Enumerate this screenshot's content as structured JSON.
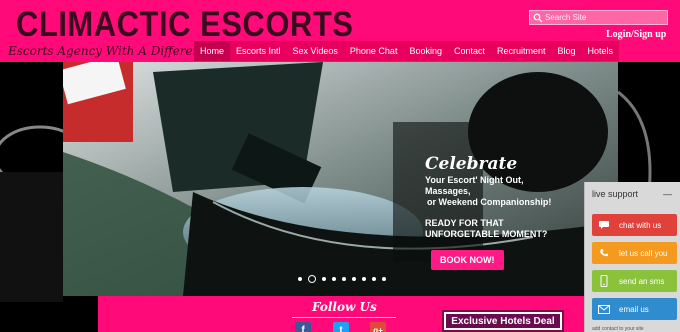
{
  "brand": {
    "logo": "CLIMACTIC ESCORTS",
    "tagline": "Escorts Agency With A Difference"
  },
  "search": {
    "placeholder": "Search Site"
  },
  "auth": {
    "login_label": "Login/Sign up"
  },
  "nav": {
    "items": [
      {
        "label": "Home",
        "active": true
      },
      {
        "label": "Escorts Intl",
        "active": false
      },
      {
        "label": "Sex Videos",
        "active": false
      },
      {
        "label": "Phone Chat",
        "active": false
      },
      {
        "label": "Booking",
        "active": false
      },
      {
        "label": "Contact",
        "active": false
      },
      {
        "label": "Recruitment",
        "active": false
      },
      {
        "label": "Blog",
        "active": false
      },
      {
        "label": "Hotels",
        "active": false
      }
    ]
  },
  "slider": {
    "heading": "Celebrate",
    "line1": "Your Escort' Night Out,",
    "line2": "Massages,",
    "line3": "or Weekend Companionship!",
    "ready1": "READY FOR THAT",
    "ready2": "UNFORGETABLE MOMENT?",
    "cta": "BOOK NOW!",
    "dot_count": 9,
    "active_dot": 1
  },
  "footer": {
    "follow_title": "Follow Us",
    "social": [
      "facebook-icon",
      "twitter-icon",
      "google-plus-icon"
    ],
    "hotels_deal": "Exclusive Hotels Deal"
  },
  "live_support": {
    "title": "live support",
    "toggle": "—",
    "chat": "chat with us",
    "call": "let us call you",
    "sms": "send an sms",
    "email": "email us",
    "footer": "add contact to your site"
  },
  "colors": {
    "brand_pink": "#ff0a78",
    "nav_pink": "#e8005f",
    "chat_red": "#e0413b",
    "call_orange": "#f39a1f",
    "sms_green": "#8ac23c",
    "email_blue": "#2e8ccf"
  }
}
